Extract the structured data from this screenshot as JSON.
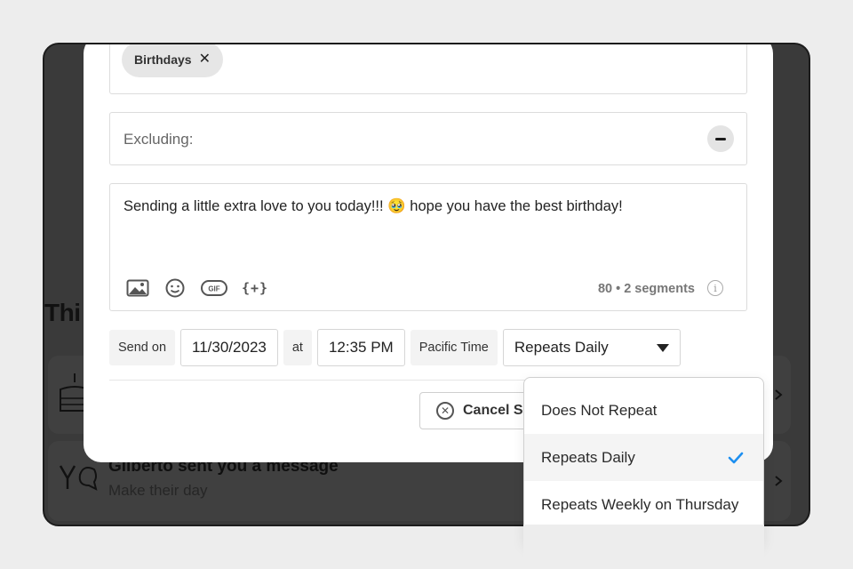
{
  "background": {
    "section_heading": "Thi",
    "cards": [
      {
        "title": "",
        "subtitle": ""
      },
      {
        "title": "Gilberto sent you a message",
        "subtitle": "Make their day"
      }
    ]
  },
  "modal": {
    "include_chips": [
      {
        "label": "Birthdays",
        "remove": "✕"
      }
    ],
    "exclude_label": "Excluding:",
    "message_text": "Sending a little extra love to you today!!! 🥹 hope you have the best birthday!",
    "tools": {
      "gif_label": "GIF",
      "merge_label": "{+}"
    },
    "count_text": "80 • 2 segments",
    "info_glyph": "i",
    "schedule": {
      "send_on_label": "Send on",
      "date_value": "11/30/2023",
      "at_label": "at",
      "time_value": "12:35 PM",
      "timezone_label": "Pacific Time",
      "repeat_selected": "Repeats Daily"
    },
    "cancel_label": "Cancel S",
    "cancel_glyph": "✕"
  },
  "dropdown": {
    "options": [
      {
        "label": "Does Not Repeat",
        "selected": false
      },
      {
        "label": "Repeats Daily",
        "selected": true
      },
      {
        "label": "Repeats Weekly on Thursday",
        "selected": false
      }
    ]
  },
  "colors": {
    "accent_check": "#1d8ff0",
    "overlay": "#3a3a3a"
  }
}
